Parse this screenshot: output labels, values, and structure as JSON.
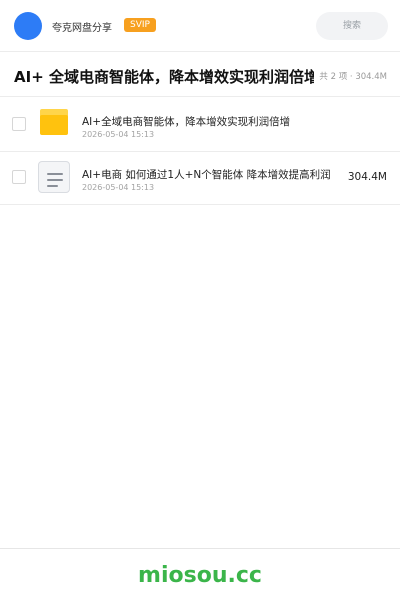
{
  "header": {
    "share_name": "夸克网盘分享",
    "svip_label": "SVIP",
    "search_placeholder": "搜索",
    "avatar_color": "#2d7cf6",
    "svip_color": "#f7a01f"
  },
  "folder": {
    "title": "AI+ 全域电商智能体，降本增效实现利润倍增",
    "summary": "共 2 项 · 304.4M"
  },
  "files": [
    {
      "icon": "folder-icon",
      "name": "AI+全域电商智能体，降本增效实现利润倍增",
      "date": "2026-05-04 15:13",
      "size": ""
    },
    {
      "icon": "document-icon",
      "name": "AI+电商 如何通过1人+N个智能体 降本增效提高利润",
      "date": "2026-05-04 15:13",
      "size": "304.4M"
    }
  ],
  "footer": {
    "watermark": "miosou.cc",
    "watermark_color": "#3bb54a"
  }
}
